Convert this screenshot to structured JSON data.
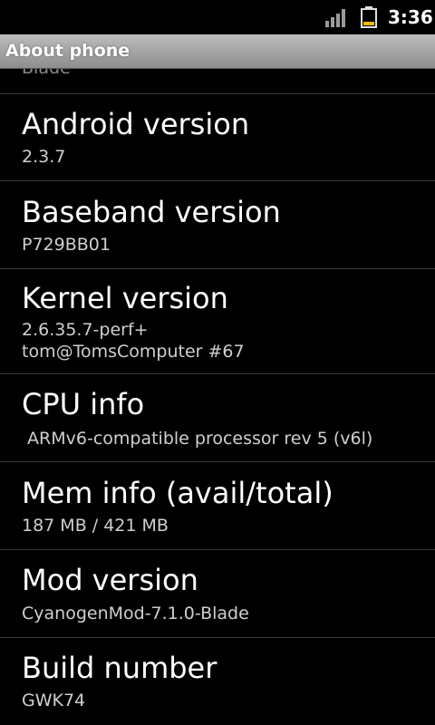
{
  "status_bar": {
    "time": "3:36",
    "signal_icon": "signal-bars-icon",
    "battery_icon": "battery-icon"
  },
  "header": {
    "title": "About phone"
  },
  "partial_item": {
    "summary": "Blade"
  },
  "items": [
    {
      "title": "Android version",
      "summary": "2.3.7"
    },
    {
      "title": "Baseband version",
      "summary": "P729BB01"
    },
    {
      "title": "Kernel version",
      "summary": "2.6.35.7-perf+\ntom@TomsComputer #67"
    },
    {
      "title": "CPU info",
      "summary": " ARMv6-compatible processor rev 5 (v6l)"
    },
    {
      "title": "Mem info (avail/total)",
      "summary": "187 MB / 421 MB"
    },
    {
      "title": "Mod version",
      "summary": "CyanogenMod-7.1.0-Blade"
    },
    {
      "title": "Build number",
      "summary": "GWK74"
    }
  ],
  "colors": {
    "battery_fill": "#f5b800",
    "title_bar": "#a2a2a2"
  }
}
